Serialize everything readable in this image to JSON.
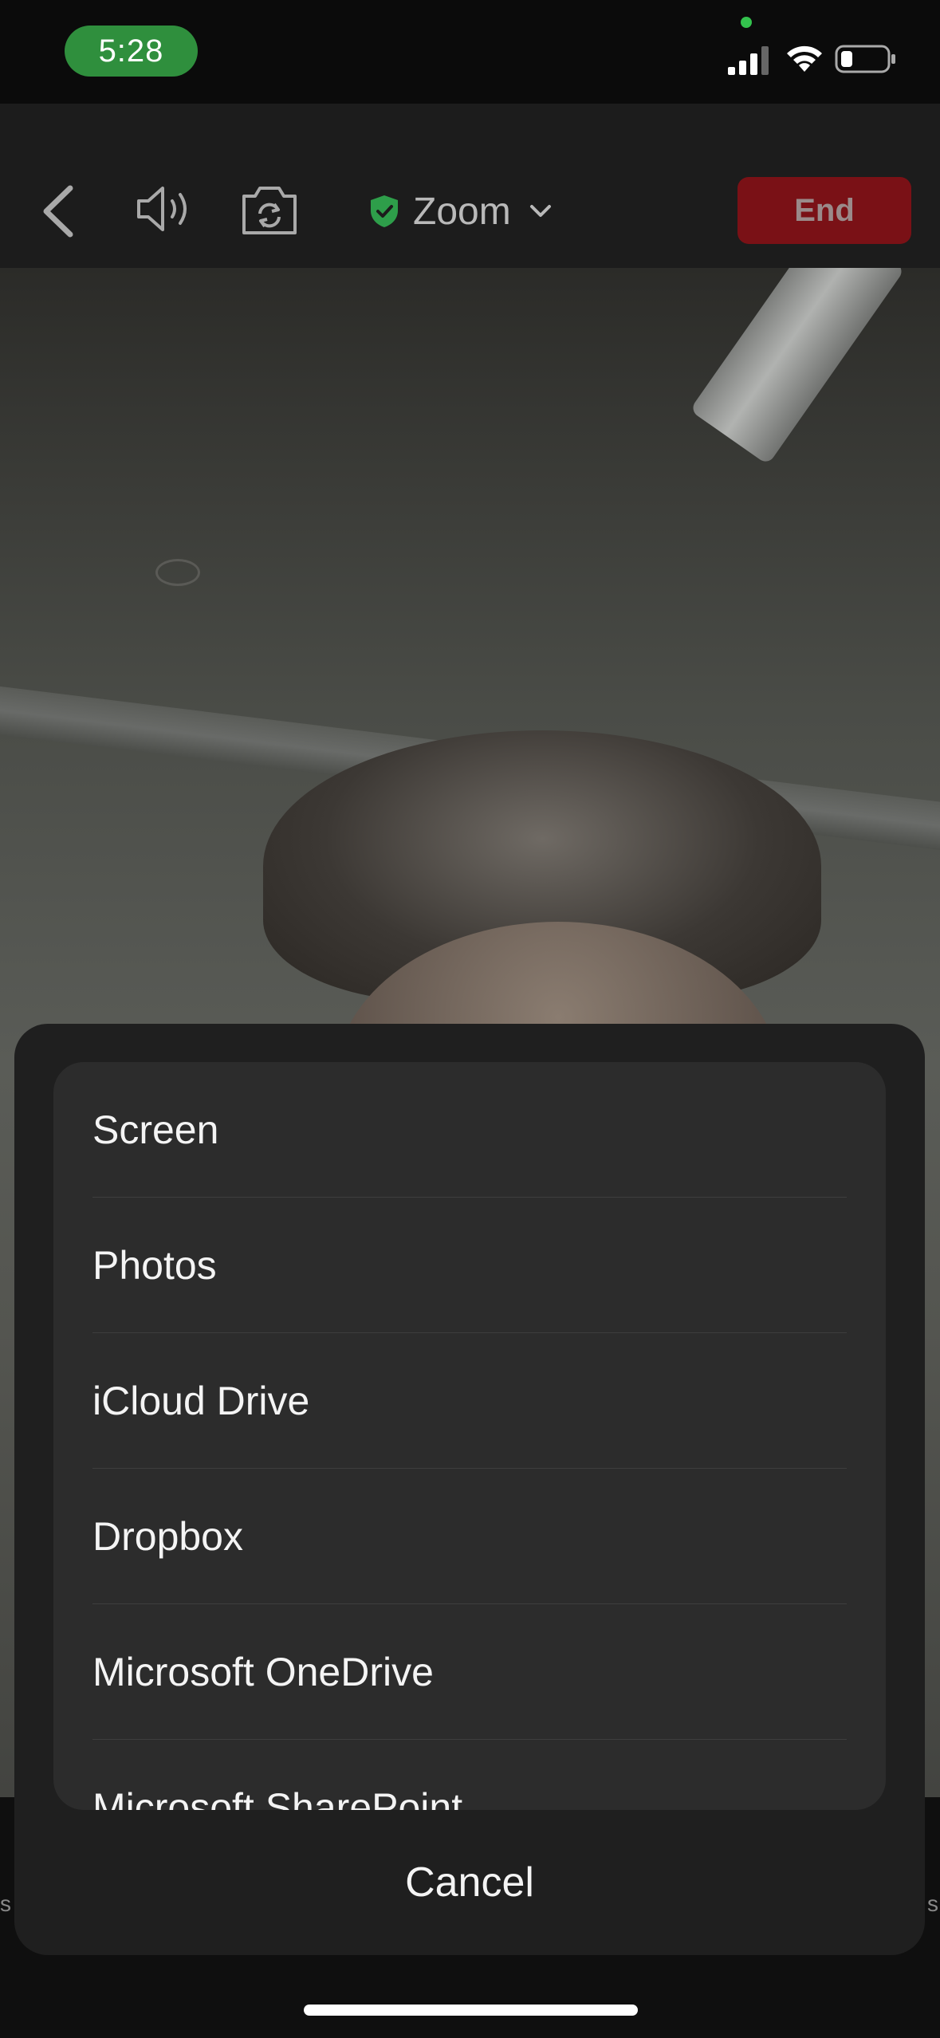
{
  "status_bar": {
    "time": "5:28",
    "signal_icon": "cellular-signal-icon",
    "wifi_icon": "wifi-icon",
    "battery_icon": "battery-low-icon",
    "camera_indicator_color": "#33c24d"
  },
  "toolbar": {
    "back_icon": "chevron-left-icon",
    "speaker_icon": "speaker-icon",
    "camera_icon": "camera-switch-icon",
    "meeting_title": "Zoom",
    "title_chevron": "chevron-down-icon",
    "end_label": "End",
    "end_color": "#7a1116",
    "shield_color": "#2e9e4a"
  },
  "share_sheet": {
    "options": [
      {
        "label": "Screen"
      },
      {
        "label": "Photos"
      },
      {
        "label": "iCloud Drive"
      },
      {
        "label": "Dropbox"
      },
      {
        "label": "Microsoft OneDrive"
      },
      {
        "label": "Microsoft SharePoint"
      }
    ],
    "cancel_label": "Cancel"
  },
  "edge_labels": {
    "left": "s",
    "right": "s"
  }
}
